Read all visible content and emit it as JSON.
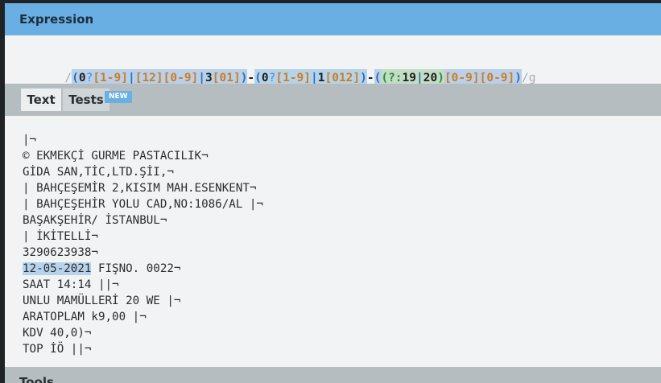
{
  "expression": {
    "header": "Expression",
    "tokens": [
      "/",
      "(",
      "0",
      "?",
      "[1-9]",
      "|",
      "[12]",
      "[0-9]",
      "|",
      "3",
      "[01]",
      ")",
      "-",
      "(",
      "0",
      "?",
      "[1-9]",
      "|",
      "1",
      "[012]",
      ")",
      "-",
      "(",
      "(?:",
      "19",
      "|",
      "20",
      ")",
      "[0-9]",
      "[0-9]",
      ")",
      "/",
      "g"
    ]
  },
  "tabs": {
    "text": "Text",
    "tests": "Tests",
    "badge": "NEW"
  },
  "text_lines": [
    "|¬",
    "© EKMEKÇİ GURME PASTACILIK¬",
    "GİDA SAN,TİC,LTD.ŞİI,¬",
    "| BAHÇEŞEMİR 2,KISIM MAH.ESENKENT¬",
    "| BAHÇEŞEHİR YOLU CAD,NO:1086/AL |¬",
    "BAŞAKŞEHİR/ İSTANBUL¬",
    "| İKİTELLİ¬",
    "3290623938¬",
    "FIŞNO. 0022¬",
    "SAAT 14:14 ||¬",
    "UNLU MAMÜLLERİ 20 WE |¬",
    "ARATOPLAM k9,00 |¬",
    "KDV 40,0)¬",
    "TOP İÖ ||¬"
  ],
  "match_text": "12-05-2021",
  "tools": {
    "label": "Tools"
  }
}
